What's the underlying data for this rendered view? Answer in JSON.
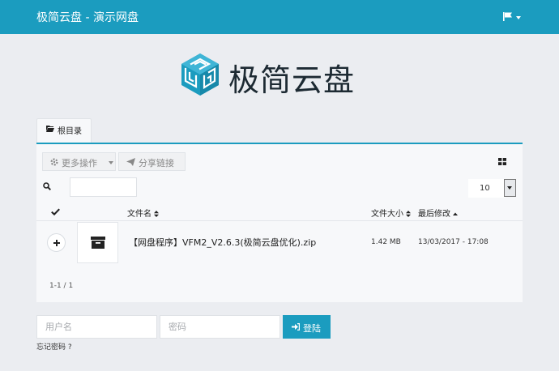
{
  "navbar": {
    "title": "极简云盘 - 演示网盘",
    "flag_icon": "flag-icon"
  },
  "logo": {
    "text": "极简云盘",
    "mark_icon": "cube-maze-logo",
    "brand_color": "#1b9cbf"
  },
  "tab": {
    "label": "根目录",
    "icon": "folder-open-icon"
  },
  "toolbar": {
    "more_actions": "更多操作",
    "share_link": "分享链接",
    "view_icon": "grid-view-icon"
  },
  "search": {
    "value": "",
    "placeholder": ""
  },
  "per_page": {
    "value": "10"
  },
  "table": {
    "headers": {
      "name": "文件名",
      "size": "文件大小",
      "modified": "最后修改"
    },
    "rows": [
      {
        "name": "【网盘程序】VFM2_V2.6.3(极简云盘优化).zip",
        "size": "1.42 MB",
        "modified": "13/03/2017 - 17:08",
        "icon": "archive-icon"
      }
    ]
  },
  "pagination": {
    "info": "1-1 / 1"
  },
  "login": {
    "username_placeholder": "用户名",
    "password_placeholder": "密码",
    "login_label": "登陆",
    "forgot_label": "忘记密码 ?"
  },
  "colors": {
    "accent": "#1b9cbf",
    "background": "#ebedf1",
    "panel": "#f7f8fa"
  }
}
